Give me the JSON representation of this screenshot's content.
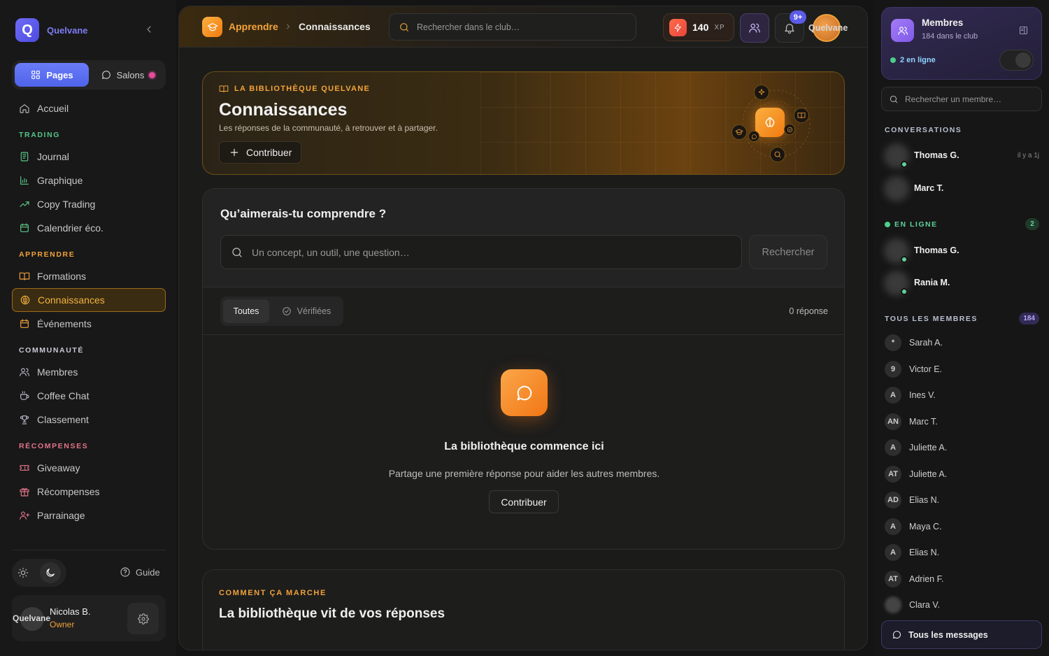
{
  "brand": {
    "name": "Quelvane",
    "logo_letter": "Q"
  },
  "sidebar": {
    "tabs": {
      "pages": "Pages",
      "salons": "Salons"
    },
    "items": [
      {
        "type": "item",
        "label": "Accueil",
        "icon": "home-icon",
        "group": "none"
      },
      {
        "type": "section",
        "label": "TRADING",
        "group": "trade"
      },
      {
        "type": "item",
        "label": "Journal",
        "icon": "journal-icon",
        "group": "trade"
      },
      {
        "type": "item",
        "label": "Graphique",
        "icon": "chart-icon",
        "group": "trade"
      },
      {
        "type": "item",
        "label": "Copy Trading",
        "icon": "trending-up-icon",
        "group": "trade"
      },
      {
        "type": "item",
        "label": "Calendrier éco.",
        "icon": "calendar-icon",
        "group": "trade"
      },
      {
        "type": "section",
        "label": "APPRENDRE",
        "group": "learn"
      },
      {
        "type": "item",
        "label": "Formations",
        "icon": "book-icon",
        "group": "learn"
      },
      {
        "type": "item",
        "label": "Connaissances",
        "icon": "brain-icon",
        "group": "learn",
        "active": true
      },
      {
        "type": "item",
        "label": "Événements",
        "icon": "calendar-icon",
        "group": "learn"
      },
      {
        "type": "section",
        "label": "COMMUNAUTÉ",
        "group": "comm"
      },
      {
        "type": "item",
        "label": "Membres",
        "icon": "users-icon",
        "group": "comm"
      },
      {
        "type": "item",
        "label": "Coffee Chat",
        "icon": "coffee-icon",
        "group": "comm"
      },
      {
        "type": "item",
        "label": "Classement",
        "icon": "trophy-icon",
        "group": "comm"
      },
      {
        "type": "section",
        "label": "RÉCOMPENSES",
        "group": "rew"
      },
      {
        "type": "item",
        "label": "Giveaway",
        "icon": "ticket-icon",
        "group": "rew"
      },
      {
        "type": "item",
        "label": "Récompenses",
        "icon": "gift-icon",
        "group": "rew"
      },
      {
        "type": "item",
        "label": "Parrainage",
        "icon": "user-plus-icon",
        "group": "rew"
      }
    ],
    "guide": "Guide",
    "user": {
      "name": "Nicolas B.",
      "role": "Owner",
      "avatar_text": "Quelvane"
    }
  },
  "topbar": {
    "crumb_parent": "Apprendre",
    "crumb_current": "Connaissances",
    "search_placeholder": "Rechercher dans le club…",
    "xp_value": "140",
    "xp_unit": "XP",
    "notif_badge": "9+",
    "avatar_text": "Quelvane"
  },
  "hero": {
    "kicker": "LA BIBLIOTHÈQUE QUELVANE",
    "title": "Connaissances",
    "subtitle": "Les réponses de la communauté, à retrouver et à partager.",
    "button": "Contribuer"
  },
  "ask": {
    "title": "Qu’aimerais-tu comprendre ?",
    "placeholder": "Un concept, un outil, une question…",
    "search_button": "Rechercher",
    "filter_all": "Toutes",
    "filter_verified": "Vérifiées",
    "count": "0 réponse",
    "empty_title": "La bibliothèque commence ici",
    "empty_sub": "Partage une première réponse pour aider les autres membres.",
    "empty_button": "Contribuer"
  },
  "how": {
    "kicker": "COMMENT ÇA MARCHE",
    "title": "La bibliothèque vit de vos réponses"
  },
  "right": {
    "members_title": "Membres",
    "members_sub": "184 dans le club",
    "online_text": "2 en ligne",
    "search_placeholder": "Rechercher un membre…",
    "conv_label": "CONVERSATIONS",
    "conversations": [
      {
        "name": "Thomas G.",
        "time": "il y a 1j",
        "online": true
      },
      {
        "name": "Marc T.",
        "time": "",
        "online": false
      }
    ],
    "online_label": "EN LIGNE",
    "online_count": "2",
    "online_members": [
      {
        "name": "Thomas G."
      },
      {
        "name": "Rania M."
      }
    ],
    "all_label": "TOUS LES MEMBRES",
    "all_count": "184",
    "members": [
      {
        "initials": "*",
        "name": "Sarah A."
      },
      {
        "initials": "9",
        "name": "Victor E."
      },
      {
        "initials": "A",
        "name": "Ines V."
      },
      {
        "initials": "AN",
        "name": "Marc T."
      },
      {
        "initials": "A",
        "name": "Juliette A."
      },
      {
        "initials": "AT",
        "name": "Juliette A."
      },
      {
        "initials": "AD",
        "name": "Elias N."
      },
      {
        "initials": "A",
        "name": "Maya C."
      },
      {
        "initials": "A",
        "name": "Elias N."
      },
      {
        "initials": "AT",
        "name": "Adrien F."
      },
      {
        "initials": "",
        "name": "Clara V."
      }
    ],
    "all_messages": "Tous les messages"
  }
}
